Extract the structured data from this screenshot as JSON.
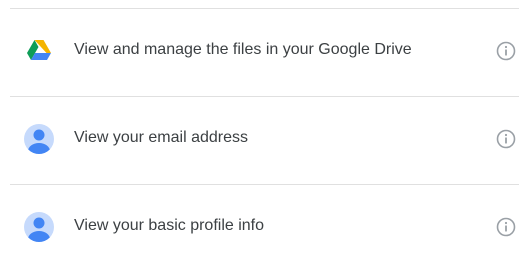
{
  "permissions": [
    {
      "label": "View and manage the files in your Google Drive",
      "icon": "google-drive-icon"
    },
    {
      "label": "View your email address",
      "icon": "profile-avatar-icon"
    },
    {
      "label": "View your basic profile info",
      "icon": "profile-avatar-icon"
    }
  ],
  "info_icon": "info-icon",
  "colors": {
    "divider": "#e0e0e0",
    "text": "#3c4043",
    "avatar_bg": "#c6dafc",
    "avatar_fg": "#4285f4",
    "drive_green": "#0f9d58",
    "drive_yellow": "#f4b400",
    "drive_blue": "#4285f4",
    "info_gray": "#9aa0a6"
  }
}
